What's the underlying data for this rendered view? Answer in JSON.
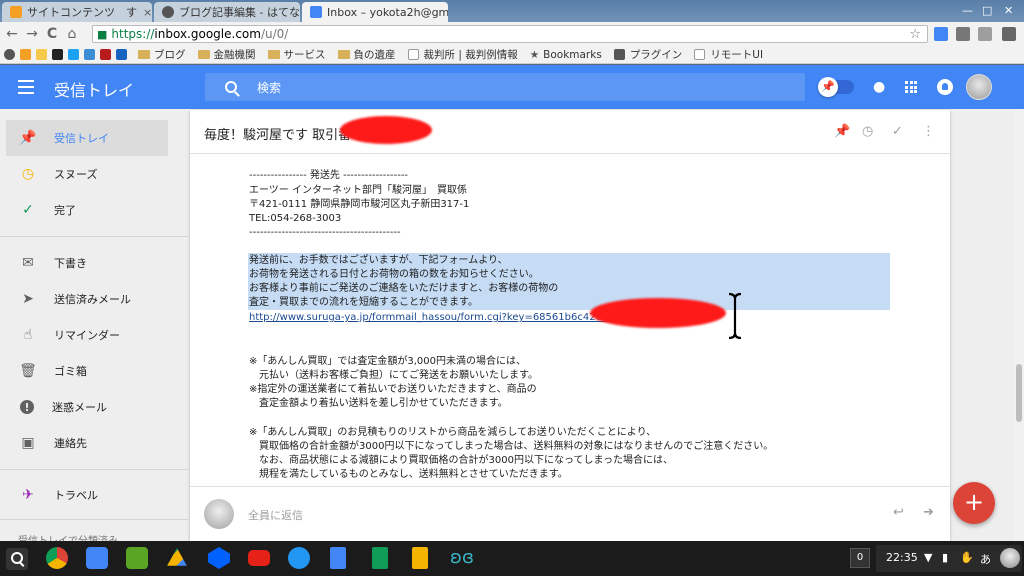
{
  "browser": {
    "tabs": [
      {
        "title": "サイトコンテンツ　す",
        "favicon_color": "#f4a024",
        "active": false
      },
      {
        "title": "ブログ記事編集 - はてな",
        "favicon_color": "#555555",
        "active": false
      },
      {
        "title": "Inbox – yokota2h@gma",
        "favicon_color": "#4285f4",
        "active": true
      }
    ],
    "tab_close": "×",
    "window_controls": [
      "—",
      "□",
      "✕"
    ],
    "url_scheme": "https://",
    "url_host": "inbox.google.com",
    "url_path": "/u/0/",
    "back_icon": "←",
    "forward_icon": "→",
    "reload_icon": "C",
    "home_icon": "⌂",
    "star_icon": "☆"
  },
  "bookmarks": [
    {
      "label": "ブログ",
      "type": "folder"
    },
    {
      "label": "金融機関",
      "type": "folder"
    },
    {
      "label": "サービス",
      "type": "folder"
    },
    {
      "label": "負の遺産",
      "type": "folder"
    },
    {
      "label": "裁判所 | 裁判例情報",
      "type": "page"
    },
    {
      "label": "Bookmarks",
      "type": "star"
    },
    {
      "label": "プラグイン",
      "type": "puzzle"
    },
    {
      "label": "リモートUI",
      "type": "page"
    }
  ],
  "header": {
    "title": "受信トレイ",
    "search_placeholder": "検索",
    "pin_icon": "📌"
  },
  "sidebar": {
    "items": [
      {
        "label": "受信トレイ",
        "icon": "pin-icon",
        "glyph": "📌",
        "active": true
      },
      {
        "label": "スヌーズ",
        "icon": "clock-icon",
        "glyph": "◷",
        "active": false
      },
      {
        "label": "完了",
        "icon": "check-icon",
        "glyph": "✓",
        "active": false
      },
      {
        "label": "下書き",
        "icon": "draft-icon",
        "glyph": "✉",
        "active": false
      },
      {
        "label": "送信済みメール",
        "icon": "send-icon",
        "glyph": "➤",
        "active": false
      },
      {
        "label": "リマインダー",
        "icon": "reminder-icon",
        "glyph": "☝",
        "active": false
      },
      {
        "label": "ゴミ箱",
        "icon": "trash-icon",
        "glyph": "🗑",
        "active": false
      },
      {
        "label": "迷惑メール",
        "icon": "spam-icon",
        "glyph": "!",
        "active": false
      },
      {
        "label": "連絡先",
        "icon": "contacts-icon",
        "glyph": "▣",
        "active": false
      },
      {
        "label": "トラベル",
        "icon": "plane-icon",
        "glyph": "✈",
        "active": false
      }
    ],
    "footer": "受信トレイで分類済み"
  },
  "email": {
    "subject": "毎度！駿河屋です 取引番号",
    "subject_actions": [
      "pin-icon",
      "snooze-icon",
      "done-icon",
      "more-icon"
    ],
    "lines": [
      "---------------- 発送先 ------------------",
      "エーツー インターネット部門「駿河屋」　買取係",
      "〒421-0111 静岡県静岡市駿河区丸子新田317-1",
      "TEL:054-268-3003",
      "------------------------------------------",
      "発送前に、お手数ではございますが、下記フォームより、",
      "お荷物を発送される日付とお荷物の箱の数をお知らせください。",
      "お客様より事前にご発送のご連絡をいただけますと、お客様の荷物の",
      "査定・買取までの流れを短縮することができます。",
      "http://www.suruga-ya.jp/formmail_hassou/form.cgi?key=68561b6c42e55886da0",
      "※「あんしん買取」では査定金額が3,000円未満の場合には、",
      "　元払い（送料お客様ご負担）にてご発送をお願いいたします。",
      "※指定外の運送業者にて着払いでお送りいただきますと、商品の",
      "　査定金額より着払い送料を差し引かせていただきます。",
      "※「あんしん買取」のお見積もりのリストから商品を減らしてお送りいただくことにより、",
      "　買取価格の合計金額が3000円以下になってしまった場合は、送料無料の対象にはなりませんのでご注意ください。",
      "　なお、商品状態による減額により買取価格の合計が3000円以下になってしまった場合には、",
      "　規程を満たしているものとみなし、送料無料とさせていただきます。"
    ],
    "reply_label": "全員に返信"
  },
  "fab_label": "+",
  "shelf": {
    "apps": [
      {
        "name": "chrome-icon",
        "color": "#e8453c"
      },
      {
        "name": "inbox-app-icon",
        "color": "#4285f4"
      },
      {
        "name": "evernote-icon",
        "color": "#5ba525"
      },
      {
        "name": "drive-icon",
        "color": "#f4b400"
      },
      {
        "name": "dropbox-icon",
        "color": "#0061fe"
      },
      {
        "name": "youtube-icon",
        "color": "#e62117"
      },
      {
        "name": "files-icon",
        "color": "#2196f3"
      },
      {
        "name": "docs-icon",
        "color": "#4285f4"
      },
      {
        "name": "sheets-icon",
        "color": "#0f9d58"
      },
      {
        "name": "slides-icon",
        "color": "#f4b400"
      },
      {
        "name": "butterfly-app-icon",
        "color": "#3ab6c8"
      }
    ],
    "notification_count": "0",
    "clock": "22:35",
    "ime_label": "あ"
  },
  "colors": {
    "accent": "#4285f4",
    "fab": "#db4437",
    "selection": "#c6dcf5"
  }
}
